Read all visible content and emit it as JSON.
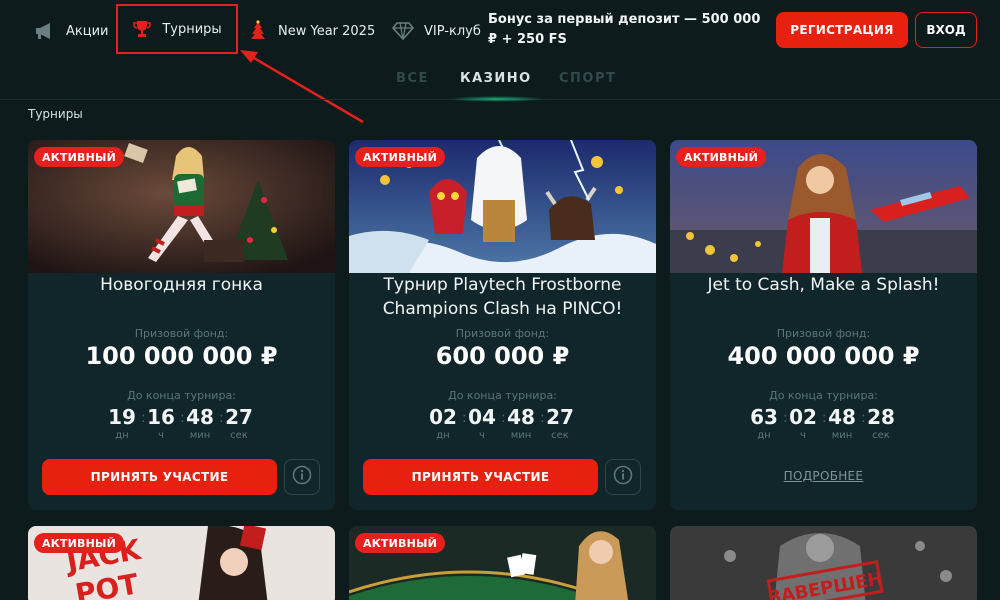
{
  "header": {
    "nav": {
      "promo": "Акции",
      "tournaments": "Турниры",
      "new_year": "New Year 2025",
      "vip": "VIP-клуб"
    },
    "bonus": "Бонус за первый депозит — 500 000 ₽ + 250 FS",
    "register": "РЕГИСТРАЦИЯ",
    "login": "ВХОД"
  },
  "tabs": [
    "ВСЕ",
    "КАЗИНО",
    "СПОРТ"
  ],
  "active_tab": "КАЗИНО",
  "section_title": "Турниры",
  "labels": {
    "prize_fund": "Призовой фонд:",
    "until_end": "До конца турнира:",
    "days": "дн",
    "hours": "ч",
    "minutes": "мин",
    "seconds": "сек",
    "join": "ПРИНЯТЬ УЧАСТИЕ",
    "more": "ПОДРОБНЕЕ"
  },
  "cards": [
    {
      "badge": "АКТИВНЫЙ",
      "title": "Новогодняя гонка",
      "prize": "100 000 000 ₽",
      "timer": {
        "d": "19",
        "h": "16",
        "m": "48",
        "s": "27"
      }
    },
    {
      "badge": "АКТИВНЫЙ",
      "title": "Турнир Playtech Frostborne Champions Clash на PINCO!",
      "prize": "600 000 ₽",
      "timer": {
        "d": "02",
        "h": "04",
        "m": "48",
        "s": "27"
      }
    },
    {
      "badge": "АКТИВНЫЙ",
      "title": "Jet to Cash, Make a Splash!",
      "prize": "400 000 000 ₽",
      "timer": {
        "d": "63",
        "h": "02",
        "m": "48",
        "s": "28"
      }
    }
  ],
  "bottom_cards": [
    {
      "badge": "АКТИВНЫЙ",
      "art_text": "JACK POT"
    },
    {
      "badge": "АКТИВНЫЙ"
    },
    {
      "stamp": "ЗАВЕРШЕН"
    }
  ],
  "colors": {
    "background": "#0d1b1c",
    "card": "#11262a",
    "accent_red": "#e8200f",
    "muted": "#5b7677"
  }
}
